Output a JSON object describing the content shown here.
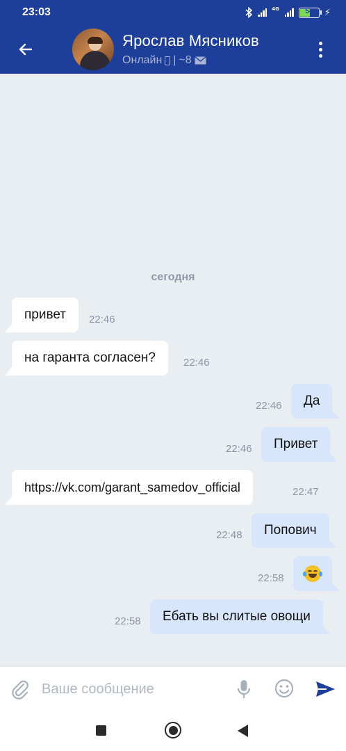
{
  "status_bar": {
    "time": "23:03",
    "network_type": "4G",
    "battery_level": "54",
    "battery_level_fraction": 0.54,
    "icons": [
      "bluetooth-icon",
      "signal-icon",
      "signal-4g-icon",
      "battery-icon",
      "charging-icon"
    ]
  },
  "header": {
    "contact_name": "Ярослав Мясников",
    "presence_status": "Онлайн",
    "separator": "|",
    "unread_count": "~8",
    "icons": [
      "back-arrow-icon",
      "avatar",
      "phone-icon",
      "mail-icon",
      "more-vertical-icon"
    ]
  },
  "chat": {
    "date_divider": "сегодня",
    "messages": [
      {
        "direction": "incoming",
        "text": "привет",
        "time": "22:46"
      },
      {
        "direction": "incoming",
        "text": "на гаранта согласен?",
        "time": "22:46"
      },
      {
        "direction": "outgoing",
        "text": "Да",
        "time": "22:46"
      },
      {
        "direction": "outgoing",
        "text": "Привет",
        "time": "22:46"
      },
      {
        "direction": "incoming",
        "text": "https://vk.com/garant_samedov_official",
        "time": "22:47"
      },
      {
        "direction": "outgoing",
        "text": "Попович",
        "time": "22:48"
      },
      {
        "direction": "outgoing",
        "text": "",
        "emoji": "laughing-tears-emoji",
        "time": "22:58"
      },
      {
        "direction": "outgoing",
        "text": "Ебать вы слитые овощи",
        "time": "22:58"
      }
    ]
  },
  "composer": {
    "placeholder": "Ваше сообщение",
    "value": "",
    "icons": [
      "attach-icon",
      "mic-icon",
      "emoji-icon",
      "send-icon"
    ]
  },
  "colors": {
    "header_bg": "#1d3f9a",
    "chat_bg": "#e9eef3",
    "incoming_bubble": "#ffffff",
    "outgoing_bubble": "#d7e6fb",
    "send_icon": "#1d3f9a"
  }
}
